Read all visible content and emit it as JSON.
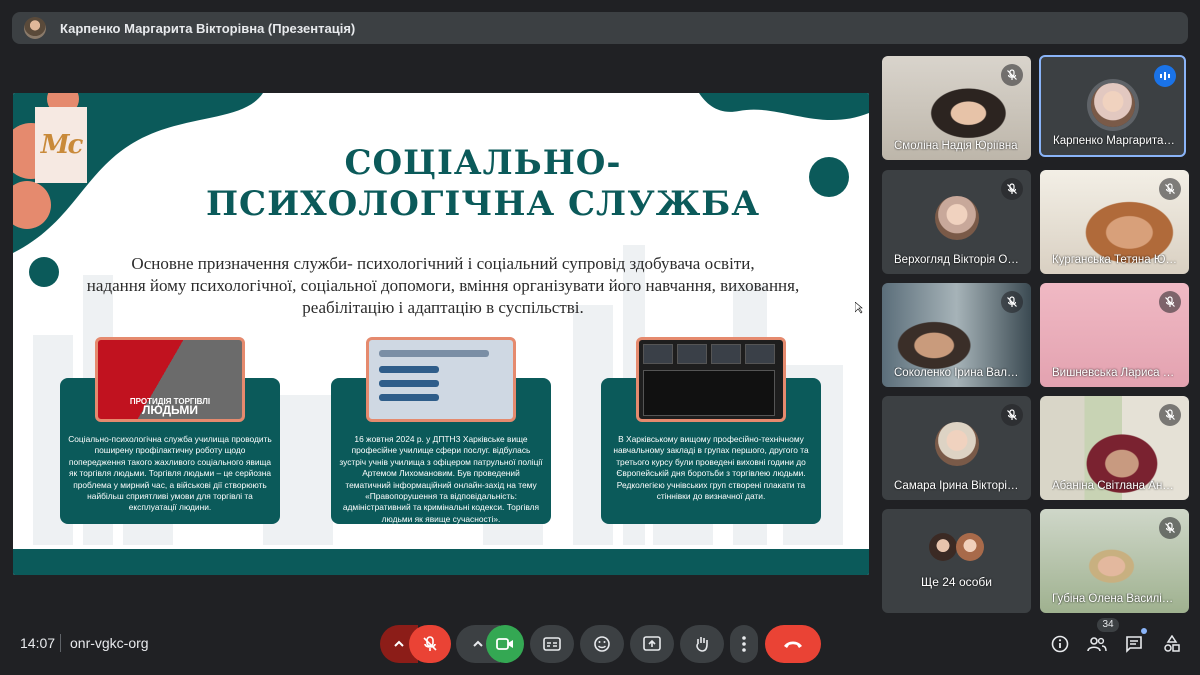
{
  "presenter_bar": {
    "title": "Карпенко Маргарита Вікторівна (Презентація)"
  },
  "slide": {
    "logo_text": "Мс",
    "title": "СОЦІАЛЬНО-ПСИХОЛОГІЧНА СЛУЖБА",
    "title_line1": "СОЦІАЛЬНО-",
    "title_line2": "ПСИХОЛОГІЧНА СЛУЖБА",
    "subtitle_line1": "Основне призначення служби- психологічний і соціальний супровід здобувача освіти,",
    "subtitle_line2": "надання йому  психологічної, соціальної допомоги, вміння організувати його навчання, виховання,",
    "subtitle_line3": "реабілітацію і адаптацію в суспільстві.",
    "photo1_small": "ПРОТИДІЯ ТОРГІВЛІ",
    "photo1_big": "ЛЮДЬМИ",
    "cards": [
      {
        "text": "Соціально-психологічна служба училища проводить поширену профілактичну роботу щодо попередження такого жахливого соціального явища як торгівля людьми. Торгівля людьми – це серйозна проблема у мирний час, а військові дії створюють найбільш сприятливі умови для торгівлі та експлуатації людини."
      },
      {
        "text": "16 жовтня 2024 р. у ДПТНЗ Харківське вище професійне училище сфери послуг. відбулась зустріч учнів училища з офіцером патрульної поліції Артемом Лихомановим. Був проведений тематичний інформаційний онлайн-захід  на тему «Правопорушення та відповідальність: адміністративний та кримінальні кодекси. Торгівля людьми як явище сучасності»."
      },
      {
        "text": "В Харківському вищому професійно-технічному навчальному закладі в групах першого, другого та третього курсу були проведені виховні години до Європейській дня боротьби з торгівлею людьми. Редколегією учнівських груп створені плакати та стіннівки до визначної дати."
      }
    ]
  },
  "participants": [
    {
      "name": "Смоліна Надія Юріївна",
      "muted": true,
      "kind": "video"
    },
    {
      "name": "Карпенко Маргарита…",
      "muted": false,
      "kind": "avatar",
      "speaking": true
    },
    {
      "name": "Верхогляд Вікторія О…",
      "muted": true,
      "kind": "avatar"
    },
    {
      "name": "Курганська Тетяна Ю…",
      "muted": true,
      "kind": "video"
    },
    {
      "name": "Соколенко Ірина Вал…",
      "muted": true,
      "kind": "video"
    },
    {
      "name": "Вишневська Лариса …",
      "muted": true,
      "kind": "video"
    },
    {
      "name": "Самара Ірина Вікторі…",
      "muted": true,
      "kind": "avatar"
    },
    {
      "name": "Абаніна Світлана Ан…",
      "muted": true,
      "kind": "video"
    },
    {
      "name": "Ще 24 особи",
      "kind": "more"
    },
    {
      "name": "Губіна Олена Василі…",
      "muted": true,
      "kind": "video"
    }
  ],
  "bottom_bar": {
    "time": "14:07",
    "meeting_code": "onr-vgkc-org",
    "participant_count": "34",
    "icons": [
      "chevron-up-icon",
      "mic-off-icon",
      "chevron-up-icon",
      "camera-icon",
      "captions-icon",
      "emoji-icon",
      "present-icon",
      "raise-hand-icon",
      "more-icon",
      "end-call-icon",
      "info-icon",
      "people-icon",
      "chat-icon",
      "activities-icon"
    ]
  },
  "colors": {
    "slide_accent": "#0b5a5a",
    "photo_border": "#e58a6e",
    "end_call": "#ea4335",
    "camera_on": "#34a853",
    "mic_off": "#8c1d18"
  }
}
